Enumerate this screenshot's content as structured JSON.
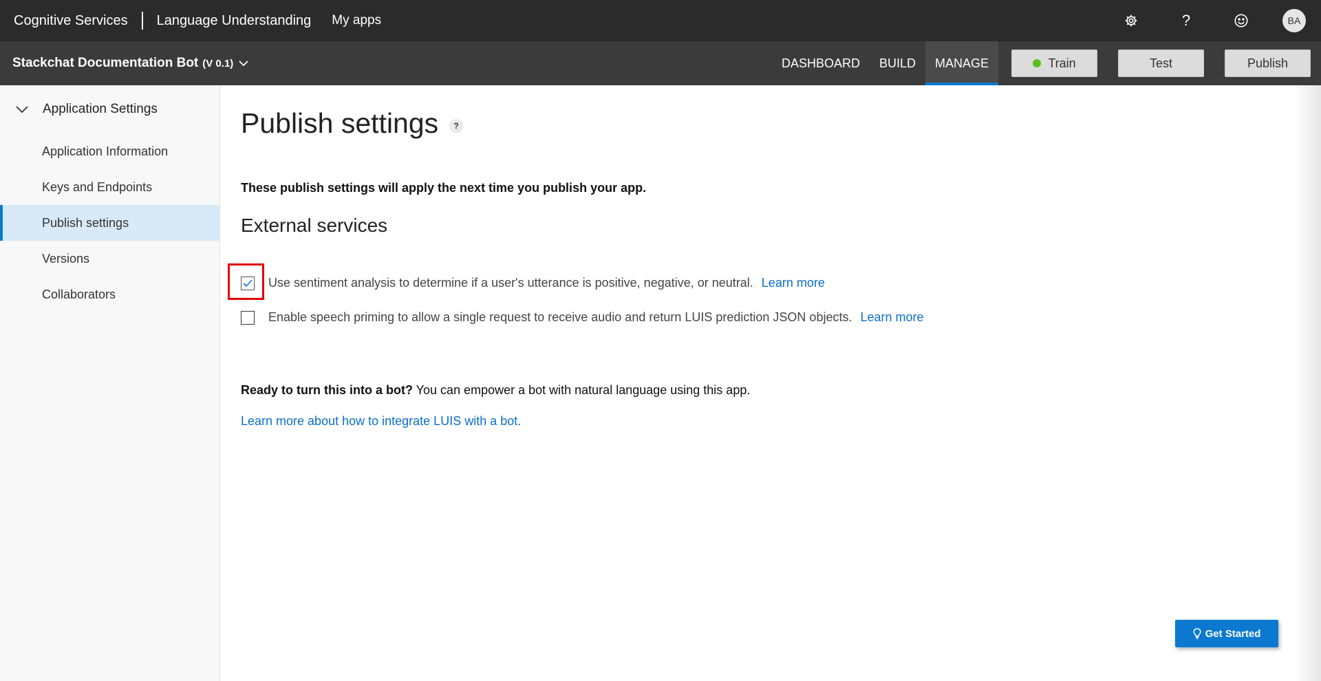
{
  "topbar": {
    "brand": "Cognitive Services",
    "product": "Language Understanding",
    "my_apps": "My apps",
    "icons": [
      "gear-icon",
      "help-icon",
      "smiley-icon"
    ],
    "avatar_initials": "BA"
  },
  "appbar": {
    "app_name": "Stackchat Documentation Bot",
    "version": "(V 0.1)",
    "nav": [
      {
        "label": "DASHBOARD",
        "active": false
      },
      {
        "label": "BUILD",
        "active": false
      },
      {
        "label": "MANAGE",
        "active": true
      }
    ],
    "train_label": "Train",
    "test_label": "Test",
    "publish_label": "Publish",
    "accent_color": "#0b79d0",
    "train_status_color": "#5bbf21"
  },
  "sidebar": {
    "header": "Application Settings",
    "items": [
      {
        "label": "Application Information",
        "active": false
      },
      {
        "label": "Keys and Endpoints",
        "active": false
      },
      {
        "label": "Publish settings",
        "active": true
      },
      {
        "label": "Versions",
        "active": false
      },
      {
        "label": "Collaborators",
        "active": false
      }
    ]
  },
  "main": {
    "title": "Publish settings",
    "help_badge": "?",
    "intro": "These publish settings will apply the next time you publish your app.",
    "section_title": "External services",
    "options": [
      {
        "text": "Use sentiment analysis to determine if a user's utterance is positive, negative, or neutral.",
        "link": "Learn more",
        "checked": true
      },
      {
        "text": "Enable speech priming to allow a single request to receive audio and return LUIS prediction JSON objects.",
        "link": "Learn more",
        "checked": false
      }
    ],
    "bot_prompt_bold": "Ready to turn this into a bot?",
    "bot_prompt_rest": " You can empower a bot with natural language using this app.",
    "bot_link": "Learn more about how to integrate LUIS with a bot."
  },
  "get_started_label": "Get Started"
}
